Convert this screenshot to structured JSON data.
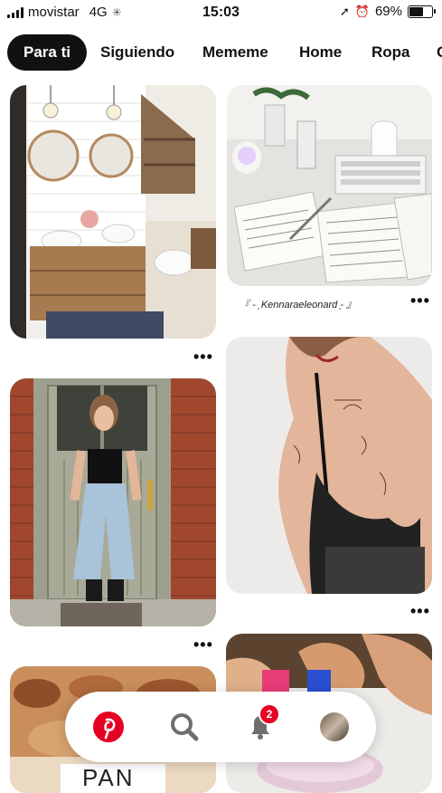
{
  "status_bar": {
    "carrier": "movistar",
    "network": "4G",
    "time": "15:03",
    "battery": "69%",
    "battery_level": 0.69
  },
  "tabs": [
    {
      "label": "Para ti",
      "active": true
    },
    {
      "label": "Siguiendo",
      "active": false
    },
    {
      "label": "Mememe",
      "active": false
    },
    {
      "label": "Home",
      "active": false
    },
    {
      "label": "Ropa",
      "active": false
    },
    {
      "label": "C",
      "active": false
    }
  ],
  "pins": {
    "bathroom": {
      "more": "•••"
    },
    "desk": {
      "caption": "『 - ̗ Kennaraeleonard ̖- 』",
      "more": "•••"
    },
    "girl": {
      "more": "•••"
    },
    "back": {
      "more": "•••"
    },
    "bread": {
      "text": "PAN"
    }
  },
  "nav": {
    "home_icon": "pinterest-logo-icon",
    "search_icon": "search-icon",
    "notifications_icon": "bell-icon",
    "notification_count": "2",
    "profile_icon": "avatar",
    "accent": "#e60023"
  }
}
